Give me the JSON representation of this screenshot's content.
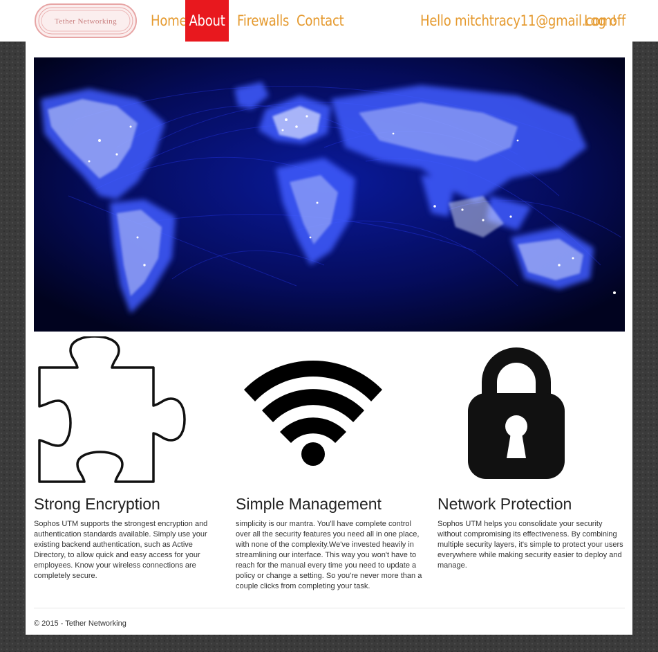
{
  "brand": {
    "name": "Tether Networking"
  },
  "nav": {
    "home": "Home",
    "about": "About",
    "firewalls": "Firewalls",
    "contact": "Contact",
    "greeting": "Hello mitchtracy11@gmail.com!",
    "logoff": "Log off"
  },
  "colors": {
    "nav_text": "#e59a2f",
    "nav_active_bg": "#e8181e",
    "hero_bg": "#02052e"
  },
  "features": [
    {
      "icon": "puzzle-piece-icon",
      "title": "Strong Encryption",
      "text": "Sophos UTM supports the strongest encryption and authentication standards available. Simply use your existing backend authentication, such as Active Directory, to allow quick and easy access for your employees. Know your wireless connections are completely secure."
    },
    {
      "icon": "wifi-icon",
      "title": "Simple Management",
      "text": "simplicity is our mantra. You'll have complete control over all the security features you need all in one place, with none of the complexity.We've invested heavily in streamlining our interface. This way you won't have to reach for the manual every time you need to update a policy or change a setting. So you're never more than a couple clicks from completing your task."
    },
    {
      "icon": "padlock-icon",
      "title": "Network Protection",
      "text": "Sophos UTM helps you consolidate your security without compromising its effectiveness. By combining multiple security layers, it's simple to protect your users everywhere while making security easier to deploy and manage."
    }
  ],
  "footer": {
    "text": "© 2015 - Tether Networking"
  }
}
